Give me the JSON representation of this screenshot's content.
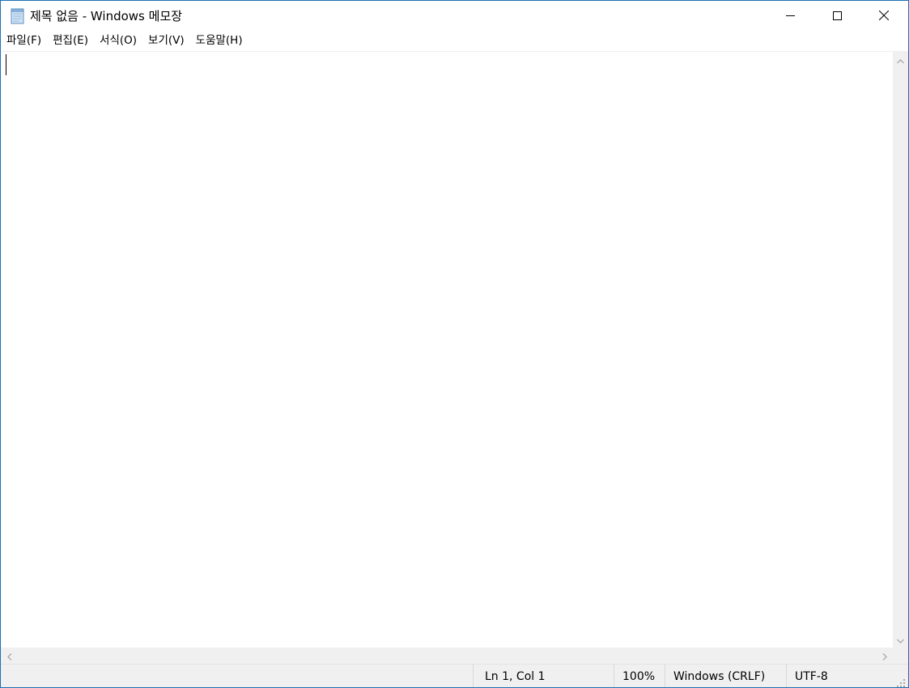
{
  "window": {
    "title": "제목 없음 - Windows 메모장",
    "app_icon": "notepad-icon",
    "border_color": "#1f6fb4"
  },
  "menu": {
    "items": [
      "파일(F)",
      "편집(E)",
      "서식(O)",
      "보기(V)",
      "도움말(H)"
    ]
  },
  "editor": {
    "content": ""
  },
  "statusbar": {
    "position": "Ln 1, Col 1",
    "zoom": "100%",
    "line_ending": "Windows (CRLF)",
    "encoding": "UTF-8"
  },
  "icons": {
    "minimize": "minimize-icon",
    "maximize": "maximize-icon",
    "close": "close-icon",
    "scroll_up": "chevron-up-icon",
    "scroll_down": "chevron-down-icon",
    "scroll_left": "chevron-left-icon",
    "scroll_right": "chevron-right-icon",
    "size_grip": "resize-grip-icon"
  }
}
